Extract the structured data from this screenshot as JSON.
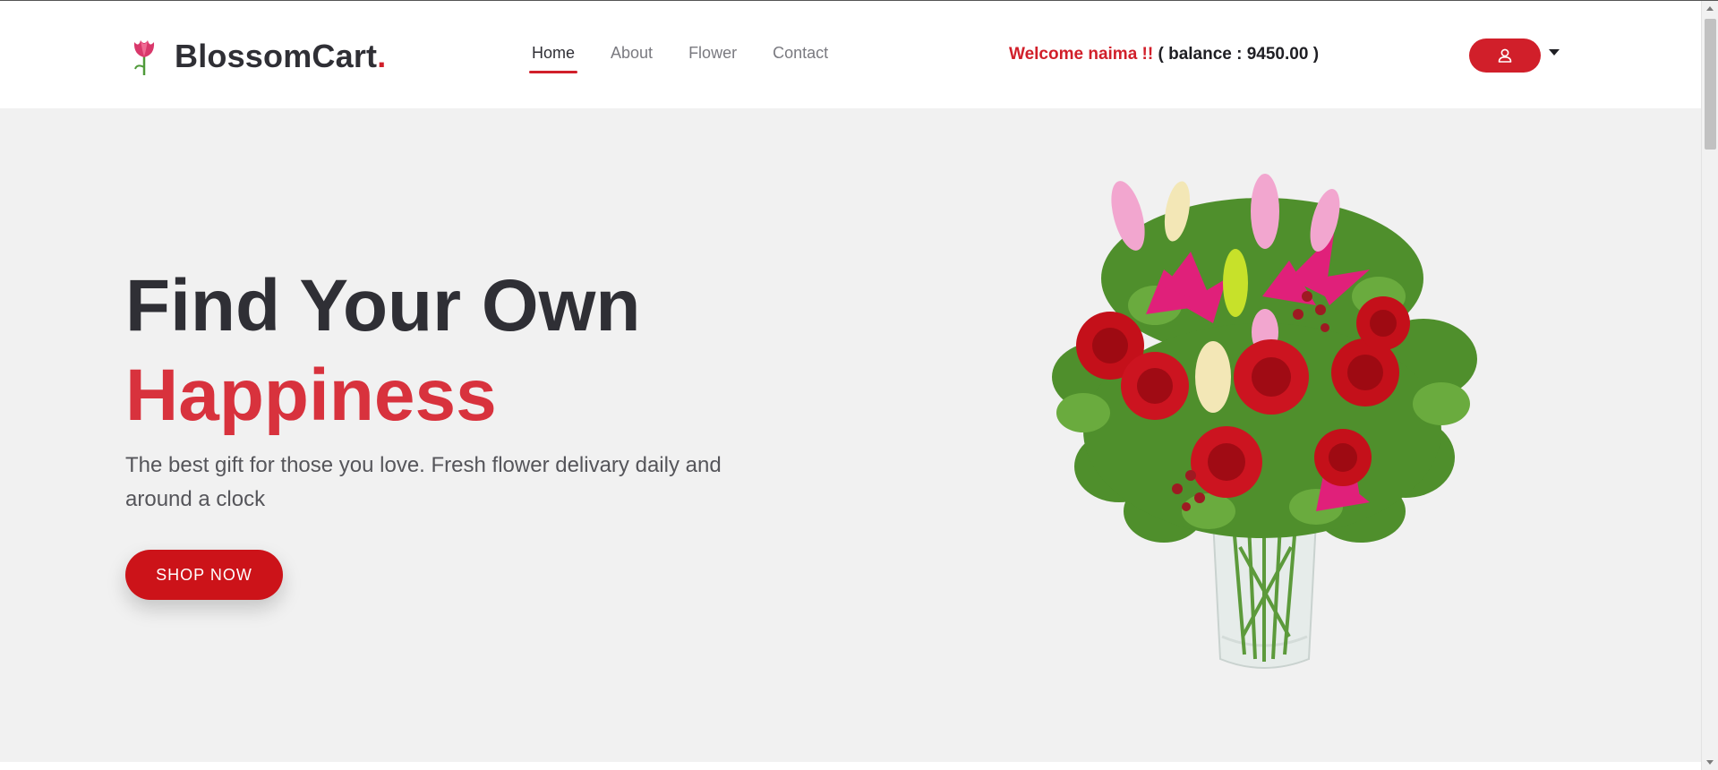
{
  "brand": {
    "name": "BlossomCart",
    "dot": ".",
    "accent_color": "#d11f2a",
    "logo_icon": "tulip-icon"
  },
  "nav": {
    "items": [
      {
        "label": "Home",
        "active": true
      },
      {
        "label": "About",
        "active": false
      },
      {
        "label": "Flower",
        "active": false
      },
      {
        "label": "Contact",
        "active": false
      }
    ]
  },
  "user": {
    "welcome": "Welcome naima !!",
    "balance": "( balance : 9450.00 )",
    "icon": "user-icon",
    "dropdown_icon": "caret-down-icon"
  },
  "hero": {
    "title_line1": "Find Your Own",
    "title_line2": "Happiness",
    "subtitle": "The best gift for those you love. Fresh flower delivary daily and around a clock",
    "button_label": "SHOP NOW",
    "image": "flower-bouquet-image"
  }
}
